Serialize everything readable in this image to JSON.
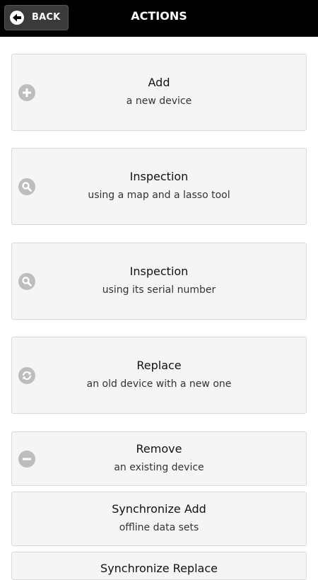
{
  "header": {
    "back_label": "BACK",
    "title": "ACTIONS"
  },
  "actions": [
    {
      "title": "Add",
      "subtitle": "a new device",
      "icon": "plus-circle-icon"
    },
    {
      "title": "Inspection",
      "subtitle": "using a map and a lasso tool",
      "icon": "search-icon"
    },
    {
      "title": "Inspection",
      "subtitle": "using its serial number",
      "icon": "search-icon"
    },
    {
      "title": "Replace",
      "subtitle": "an old device with a new one",
      "icon": "refresh-icon"
    },
    {
      "title": "Remove",
      "subtitle": "an existing device",
      "icon": "minus-circle-icon"
    },
    {
      "title": "Synchronize Add",
      "subtitle": "offline data sets"
    },
    {
      "title": "Synchronize Replace",
      "subtitle": ""
    }
  ],
  "colors": {
    "header_bg": "#000000",
    "card_bg": "#f5f5f5",
    "card_border": "#d9d9d9",
    "icon_gray": "#bdbdbd"
  }
}
